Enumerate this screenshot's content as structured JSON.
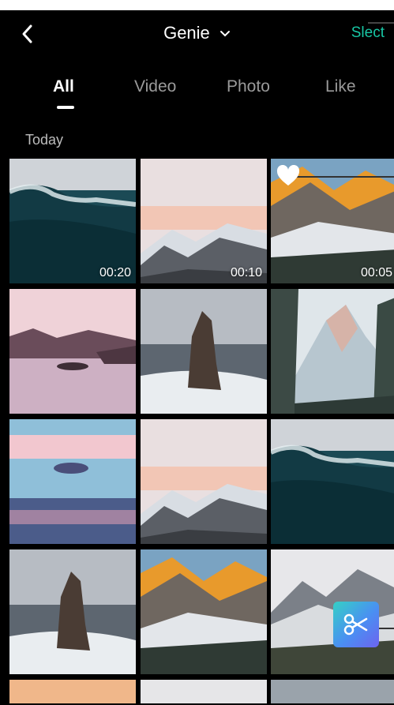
{
  "header": {
    "title": "Genie",
    "select_label": "Slect"
  },
  "tabs": [
    {
      "label": "All",
      "active": true
    },
    {
      "label": "Video",
      "active": false
    },
    {
      "label": "Photo",
      "active": false
    },
    {
      "label": "Like",
      "active": false
    }
  ],
  "section": {
    "label": "Today"
  },
  "grid": {
    "tiles": [
      {
        "scene": "wave",
        "duration": "00:20"
      },
      {
        "scene": "mountains-pink",
        "duration": "00:10"
      },
      {
        "scene": "golden-peaks",
        "duration": "00:05",
        "favorite": true
      },
      {
        "scene": "pink-lake"
      },
      {
        "scene": "sea-stack"
      },
      {
        "scene": "snowy-peak"
      },
      {
        "scene": "sunset-sea"
      },
      {
        "scene": "mountains-pink"
      },
      {
        "scene": "wave"
      },
      {
        "scene": "sea-stack"
      },
      {
        "scene": "golden-peaks"
      },
      {
        "scene": "misty-mountains"
      }
    ]
  },
  "icons": {
    "back": "chevron-left-icon",
    "title_dropdown": "chevron-down-icon",
    "favorite": "heart-icon",
    "edit": "scissors-icon"
  },
  "colors": {
    "accent": "#18c7a5",
    "background": "#000000",
    "active_tab": "#ffffff",
    "inactive_tab": "#9a9a9a"
  }
}
